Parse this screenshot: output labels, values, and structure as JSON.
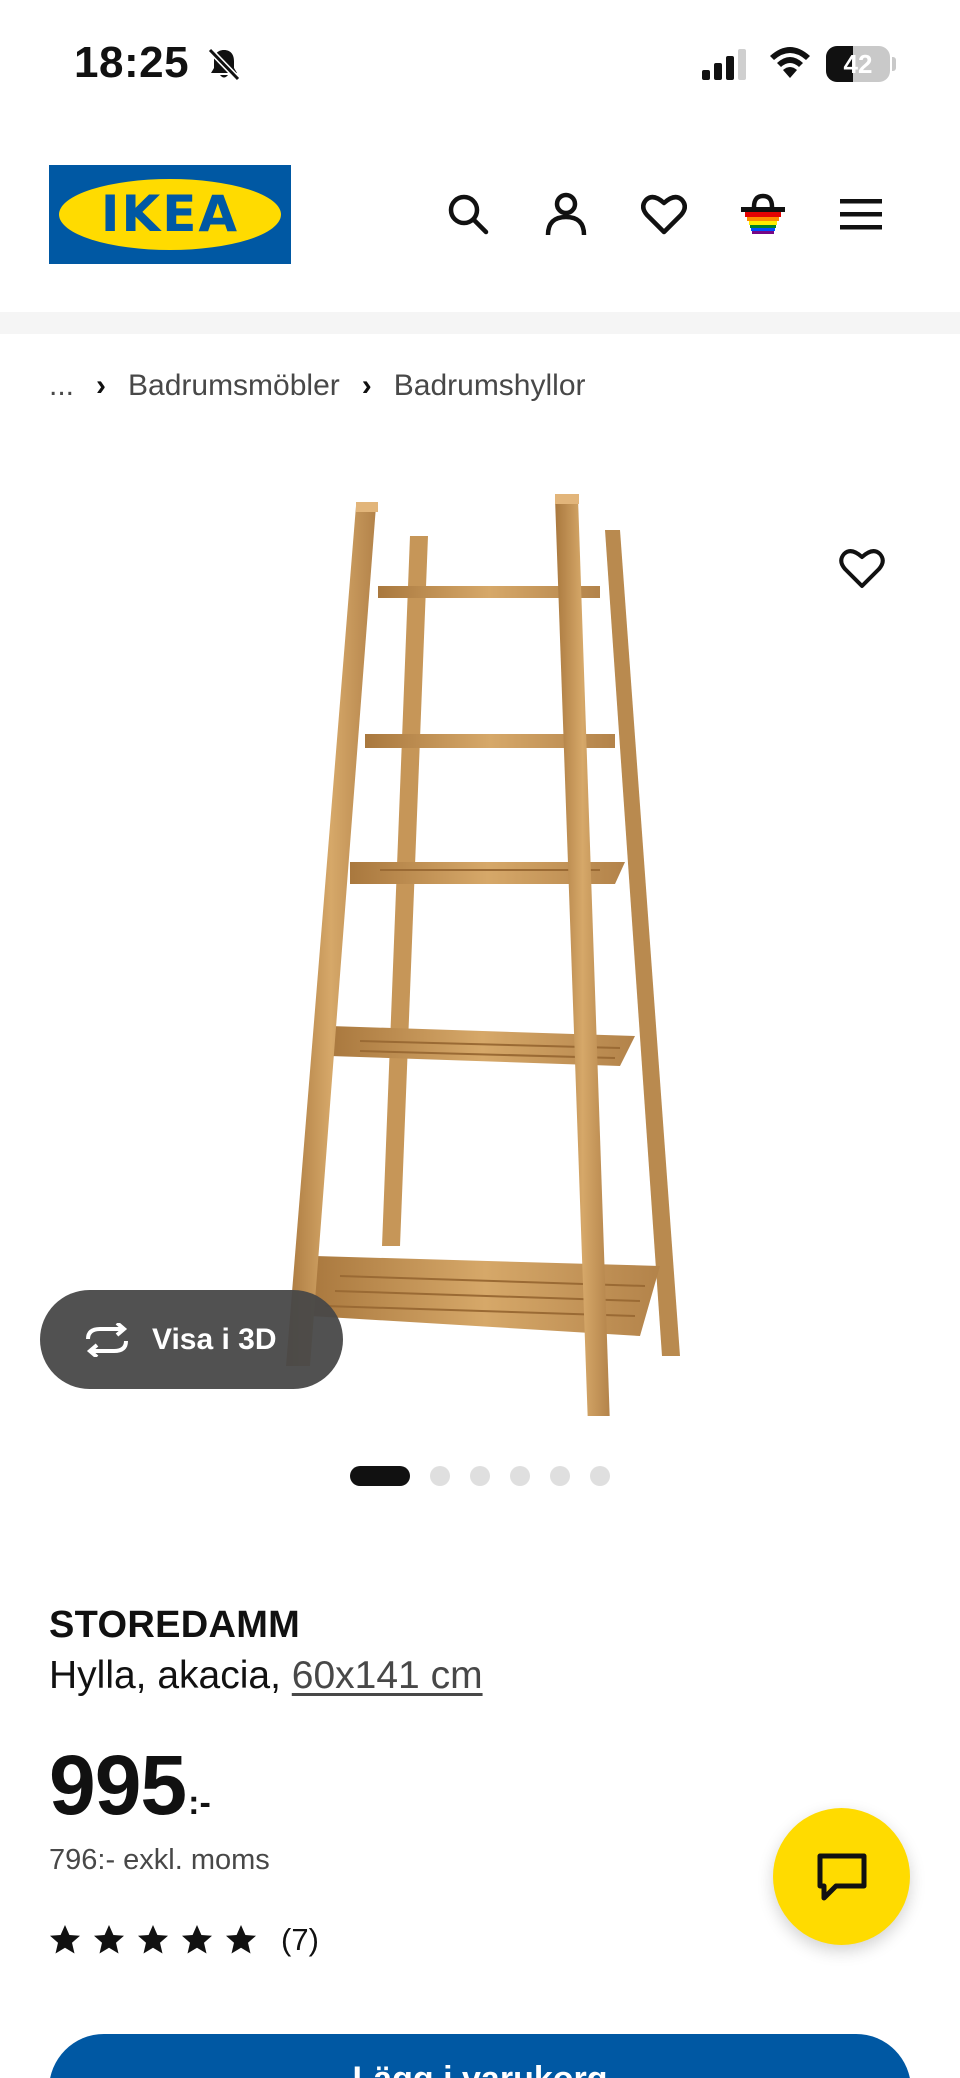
{
  "status_bar": {
    "time": "18:25",
    "battery_level": "42",
    "battery_fraction": 0.42,
    "icons": [
      "bell-slash-icon",
      "signal-icon",
      "wifi-icon",
      "battery-icon"
    ]
  },
  "header": {
    "logo_text": "IKEA",
    "icons": [
      "search-icon",
      "account-icon",
      "heart-icon",
      "cart-icon",
      "menu-icon"
    ]
  },
  "breadcrumb": {
    "ellipsis": "...",
    "items": [
      "Badrumsmöbler",
      "Badrumshyllor"
    ]
  },
  "gallery": {
    "view_3d_label": "Visa i 3D",
    "image_count": 6,
    "active_index": 0
  },
  "product": {
    "name": "STOREDAMM",
    "description": "Hylla, akacia,",
    "size": "60x141 cm",
    "price_integer": "995",
    "price_suffix": ":-",
    "price_ex_vat": "796:- exkl. moms",
    "rating_value": 5,
    "rating_count": "(7)"
  },
  "cart_button": {
    "label": "Lägg i varukorg"
  },
  "colors": {
    "ikea_blue": "#0058a3",
    "ikea_yellow": "#ffdb00",
    "text": "#111111",
    "secondary_text": "#484848"
  }
}
